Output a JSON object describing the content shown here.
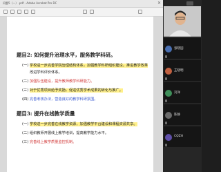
{
  "pdf": {
    "title": "问题5（一）.pdf - Adobe Acrobat Pro DC",
    "page": {
      "heading1": "题目2: 如何提升治理水平，服务教学科研。",
      "h1_items": [
        {
          "prefix": "(一)",
          "text": "学校进一步完善学院治理结构体系，加强教学科研组织建设，推进教学改革"
        },
        {
          "prefix": "",
          "text": "改进学科评价体系。"
        },
        {
          "prefix": "(二)",
          "text": "加强队伍建设，提升教师教学科研能力。"
        },
        {
          "prefix": "(三)",
          "text": "对于优秀项目给予奖励，促进优秀学术成果的转化与推广。"
        },
        {
          "prefix": "(四)",
          "text": "完善考核办法，营造良好的教学科研氛围。"
        }
      ],
      "heading2": "题目3: 提升在线教学质量",
      "h2_items": [
        {
          "prefix": "(一)",
          "text": "学校进一步完善在线教学资源，加强教学平台建设和课程资源共享。"
        },
        {
          "prefix": "(二)",
          "text": "组织教师开展线上教学培训，提高教学能力水平。"
        },
        {
          "prefix": "(三)",
          "text": "完善线上教学质量监控机制。"
        }
      ]
    }
  },
  "participants": [
    {
      "name": "张晓园",
      "color": "#4a6fb0"
    },
    {
      "name": "王晓明",
      "color": "#c06040"
    },
    {
      "name": "刘洋",
      "color": "#3f8f5a"
    },
    {
      "name": "陈静",
      "color": "#6a6a6a"
    },
    {
      "name": "CQZH",
      "color": "#5f4fa8"
    }
  ]
}
